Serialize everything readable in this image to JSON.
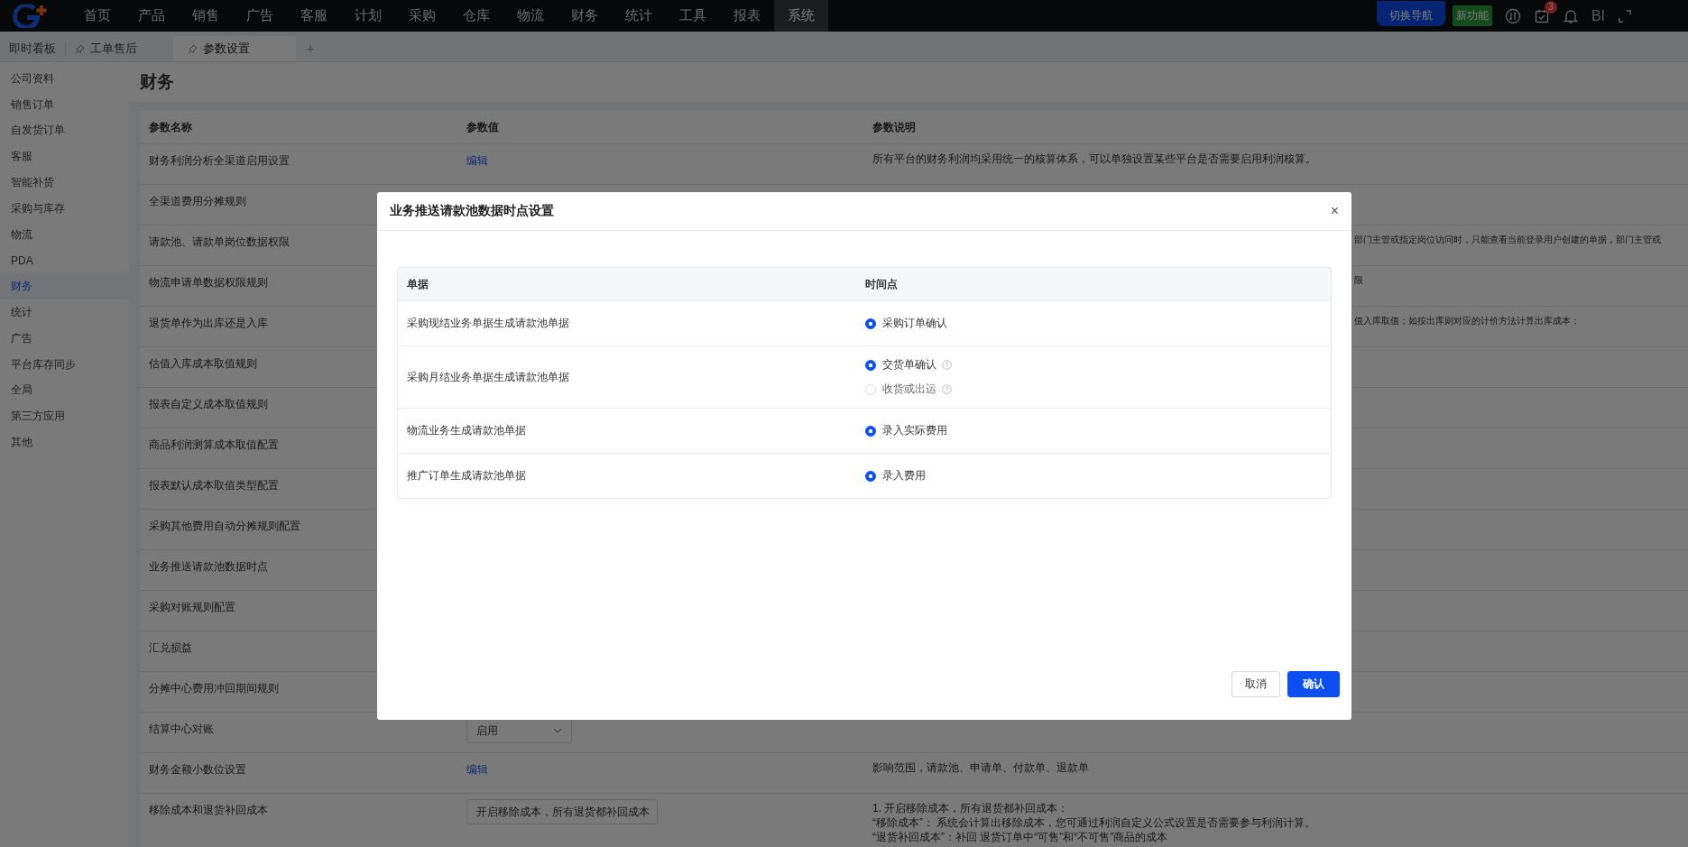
{
  "nav": {
    "items": [
      {
        "label": "首页",
        "selected": false
      },
      {
        "label": "产品",
        "selected": false
      },
      {
        "label": "销售",
        "selected": false
      },
      {
        "label": "广告",
        "selected": false
      },
      {
        "label": "客服",
        "selected": false
      },
      {
        "label": "计划",
        "selected": false
      },
      {
        "label": "采购",
        "selected": false
      },
      {
        "label": "仓库",
        "selected": false
      },
      {
        "label": "物流",
        "selected": false
      },
      {
        "label": "财务",
        "selected": false
      },
      {
        "label": "统计",
        "selected": false
      },
      {
        "label": "工具",
        "selected": false
      },
      {
        "label": "报表",
        "selected": false
      },
      {
        "label": "系统",
        "selected": true
      }
    ],
    "switch_button": "切换导航",
    "new_feature": "新功能",
    "task_badge": "3",
    "bi": "BI"
  },
  "tabs": [
    {
      "label": "即时看板",
      "pinned": false,
      "selected": false
    },
    {
      "label": "工单售后",
      "pinned": true,
      "selected": false
    },
    {
      "label": "参数设置",
      "pinned": true,
      "selected": true
    }
  ],
  "add_tab": "+",
  "sidebar": {
    "items": [
      {
        "label": "公司资料",
        "selected": false
      },
      {
        "label": "销售订单",
        "selected": false
      },
      {
        "label": "自发货订单",
        "selected": false
      },
      {
        "label": "客服",
        "selected": false
      },
      {
        "label": "智能补货",
        "selected": false
      },
      {
        "label": "采购与库存",
        "selected": false
      },
      {
        "label": "物流",
        "selected": false
      },
      {
        "label": "PDA",
        "selected": false
      },
      {
        "label": "财务",
        "selected": true
      },
      {
        "label": "统计",
        "selected": false
      },
      {
        "label": "广告",
        "selected": false
      },
      {
        "label": "平台库存同步",
        "selected": false
      },
      {
        "label": "全局",
        "selected": false
      },
      {
        "label": "第三方应用",
        "selected": false
      },
      {
        "label": "其他",
        "selected": false
      }
    ]
  },
  "page_title": "财务",
  "table": {
    "columns": [
      "参数名称",
      "参数值",
      "参数说明"
    ],
    "rows": [
      {
        "name": "财务利润分析全渠道启用设置",
        "value": {
          "kind": "link",
          "text": "编辑"
        },
        "description": [
          "所有平台的财务利润均采用统一的核算体系，可以单独设置某些平台是否需要启用利润核算。"
        ]
      },
      {
        "name": "全渠道费用分摊规则"
      },
      {
        "name": "请款池、请款单岗位数据权限",
        "description": [
          "部门主管或指定岗位访问时，只能查看当前登录用户创建的单据，部门主管或"
        ],
        "covered": true
      },
      {
        "name": "物流申请单数据权限规则",
        "description": [
          "限"
        ],
        "covered": true
      },
      {
        "name": "退货单作为出库还是入库",
        "description": [
          "值入库取值；如按出库则对应的计价方法计算出库成本；"
        ],
        "covered": true
      },
      {
        "name": "估值入库成本取值规则"
      },
      {
        "name": "报表自定义成本取值规则"
      },
      {
        "name": "商品利润测算成本取值配置"
      },
      {
        "name": "报表默认成本取值类型配置"
      },
      {
        "name": "采购其他费用自动分摊规则配置"
      },
      {
        "name": "业务推送请款池数据时点"
      },
      {
        "name": "采购对账规则配置"
      },
      {
        "name": "汇兑损益"
      },
      {
        "name": "分摊中心费用冲回期间规则"
      },
      {
        "name": "结算中心对账",
        "value": {
          "kind": "select",
          "text": "启用"
        }
      },
      {
        "name": "财务金额小数位设置",
        "value": {
          "kind": "link",
          "text": "编辑"
        },
        "description": [
          "影响范围，请款池、申请单、付款单、退款单"
        ]
      },
      {
        "name": "移除成本和退货补回成本",
        "value": {
          "kind": "select",
          "text": "开启移除成本，所有退货都补回成本"
        },
        "description": [
          "1. 开启移除成本，所有退货都补回成本：",
          "“移除成本”： 系统会计算出移除成本，您可通过利润自定义公式设置是否需要参与利润计算。",
          "“退货补回成本”：补回 退货订单中“可售”和“不可售”商品的成本"
        ]
      }
    ]
  },
  "dialog": {
    "title": "业务推送请款池数据时点设置",
    "close": "×",
    "columns": [
      "单据",
      "时间点"
    ],
    "rows": [
      {
        "document": "采购现结业务单据生成请款池单据",
        "options": [
          {
            "label": "采购订单确认",
            "selected": true,
            "help": false
          }
        ]
      },
      {
        "document": "采购月结业务单据生成请款池单据",
        "options": [
          {
            "label": "交货单确认",
            "selected": true,
            "help": true
          },
          {
            "label": "收货或出运",
            "selected": false,
            "help": true
          }
        ]
      },
      {
        "document": "物流业务生成请款池单据",
        "options": [
          {
            "label": "录入实际费用",
            "selected": true,
            "help": false
          }
        ]
      },
      {
        "document": "推广订单生成请款池单据",
        "options": [
          {
            "label": "录入费用",
            "selected": true,
            "help": false
          }
        ]
      }
    ],
    "buttons": [
      {
        "label": "取消",
        "kind": "secondary"
      },
      {
        "label": "确认",
        "kind": "primary"
      }
    ]
  }
}
